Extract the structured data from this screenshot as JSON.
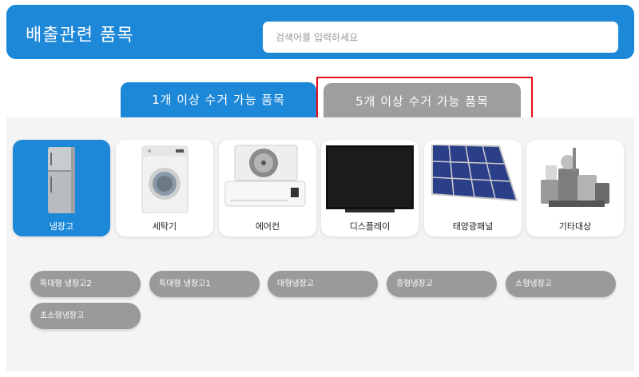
{
  "header": {
    "title": "배출관련 품목",
    "search_placeholder": "검색어를 입력하세요"
  },
  "tabs": [
    {
      "label": "1개 이상 수거 가능 품목",
      "active": true
    },
    {
      "label": "5개 이상 수거 가능 품목",
      "active": false
    }
  ],
  "categories": [
    {
      "label": "냉장고",
      "icon": "refrigerator-icon",
      "selected": true
    },
    {
      "label": "세탁기",
      "icon": "washing-machine-icon",
      "selected": false
    },
    {
      "label": "에어컨",
      "icon": "air-conditioner-icon",
      "selected": false
    },
    {
      "label": "디스플레이",
      "icon": "display-icon",
      "selected": false
    },
    {
      "label": "태양광패널",
      "icon": "solar-panel-icon",
      "selected": false
    },
    {
      "label": "기타대상",
      "icon": "misc-appliances-icon",
      "selected": false
    }
  ],
  "subitems": [
    "특대형 냉장고2",
    "특대형 냉장고1",
    "대형냉장고",
    "중형냉장고",
    "소형냉장고",
    "초소형냉장고"
  ],
  "colors": {
    "primary": "#1e88d8",
    "inactive_tab": "#9e9e9e",
    "chip": "#9a9a9a",
    "highlight": "#e8101a",
    "panel_bg": "#f4f4f4"
  }
}
